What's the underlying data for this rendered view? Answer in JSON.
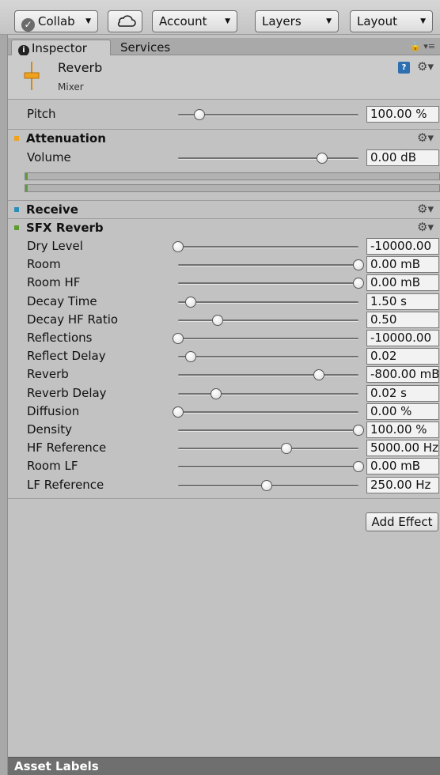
{
  "toolbar": {
    "collab": "Collab",
    "account": "Account",
    "layers": "Layers",
    "layout": "Layout"
  },
  "tabs": [
    {
      "label": "Inspector",
      "active": true
    },
    {
      "label": "Services",
      "active": false
    }
  ],
  "header": {
    "title": "Reverb",
    "subtitle": "Mixer"
  },
  "pitch": {
    "label": "Pitch",
    "value": "100.00 %",
    "level": 0.12
  },
  "attenuation": {
    "title": "Attenuation",
    "color": "#f0a21b",
    "volume": {
      "label": "Volume",
      "value": "0.00 dB",
      "level": 0.8
    },
    "meters": [
      0.0,
      0.0
    ]
  },
  "receive": {
    "title": "Receive",
    "color": "#2a8fb8"
  },
  "sfx_reverb": {
    "title": "SFX Reverb",
    "color": "#5d9c31",
    "params": [
      {
        "label": "Dry Level",
        "value": "-10000.00",
        "level": 0.0
      },
      {
        "label": "Room",
        "value": "0.00 mB",
        "level": 1.0
      },
      {
        "label": "Room HF",
        "value": "0.00 mB",
        "level": 1.0
      },
      {
        "label": "Decay Time",
        "value": "1.50 s",
        "level": 0.07
      },
      {
        "label": "Decay HF Ratio",
        "value": "0.50",
        "level": 0.22
      },
      {
        "label": "Reflections",
        "value": "-10000.00",
        "level": 0.0
      },
      {
        "label": "Reflect Delay",
        "value": "0.02",
        "level": 0.07
      },
      {
        "label": "Reverb",
        "value": "-800.00 mB",
        "level": 0.78
      },
      {
        "label": "Reverb Delay",
        "value": "0.02 s",
        "level": 0.21
      },
      {
        "label": "Diffusion",
        "value": "0.00 %",
        "level": 0.0
      },
      {
        "label": "Density",
        "value": "100.00 %",
        "level": 1.0
      },
      {
        "label": "HF Reference",
        "value": "5000.00 Hz",
        "level": 0.6
      },
      {
        "label": "Room LF",
        "value": "0.00 mB",
        "level": 1.0
      },
      {
        "label": "LF Reference",
        "value": "250.00 Hz",
        "level": 0.49
      }
    ]
  },
  "add_effect": "Add Effect",
  "asset_labels": "Asset Labels"
}
